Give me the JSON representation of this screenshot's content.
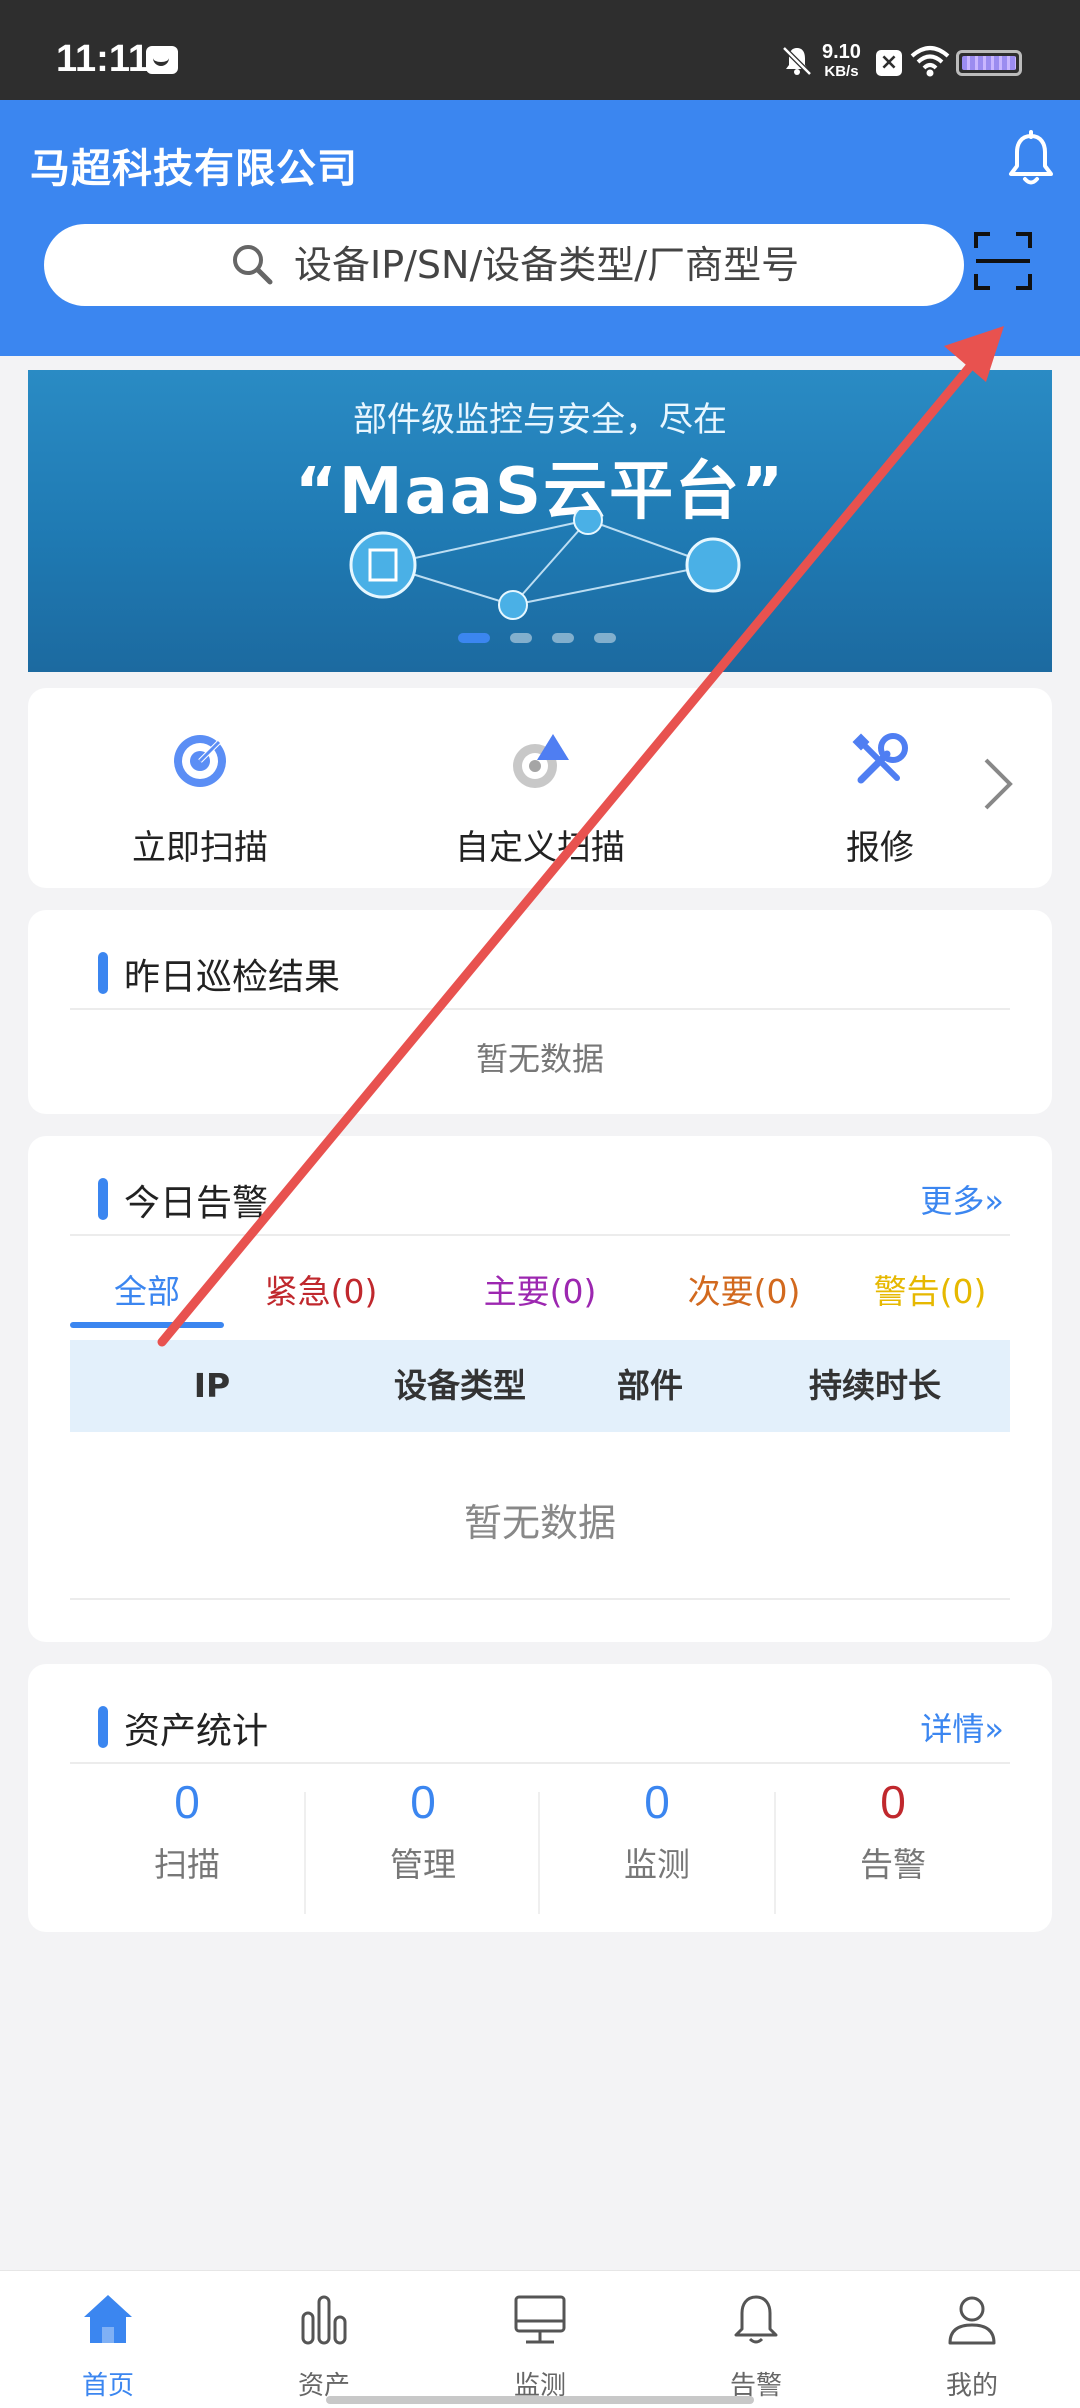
{
  "status_bar": {
    "time": "11:11",
    "net_speed_value": "9.10",
    "net_speed_unit": "KB/s",
    "x_badge": "×"
  },
  "header": {
    "company": "马超科技有限公司",
    "search_placeholder": "设备IP/SN/设备类型/厂商型号"
  },
  "banner": {
    "subtitle": "部件级监控与安全，尽在",
    "title": "“MaaS云平台”",
    "slide_count": 4,
    "active_slide": 1
  },
  "quick_actions": {
    "items": [
      {
        "label": "立即扫描",
        "icon": "target-icon"
      },
      {
        "label": "自定义扫描",
        "icon": "custom-scan-icon"
      },
      {
        "label": "报修",
        "icon": "wrench-icon"
      }
    ]
  },
  "yesterday": {
    "title": "昨日巡检结果",
    "empty": "暂无数据"
  },
  "today_alerts": {
    "title": "今日告警",
    "more": "更多»",
    "tabs": [
      {
        "label": "全部",
        "color": "#3b86f0"
      },
      {
        "label": "紧急(0)",
        "color": "#c0282d"
      },
      {
        "label": "主要(0)",
        "color": "#9c27b0"
      },
      {
        "label": "次要(0)",
        "color": "#d2691e"
      },
      {
        "label": "警告(0)",
        "color": "#e6b800"
      }
    ],
    "columns": [
      "IP",
      "设备类型",
      "部件",
      "持续时长"
    ],
    "empty": "暂无数据"
  },
  "assets": {
    "title": "资产统计",
    "details": "详情»",
    "stats": [
      {
        "value": "0",
        "label": "扫描",
        "color": "#3b86f0"
      },
      {
        "value": "0",
        "label": "管理",
        "color": "#3b86f0"
      },
      {
        "value": "0",
        "label": "监测",
        "color": "#3b86f0"
      },
      {
        "value": "0",
        "label": "告警",
        "color": "#c0282d"
      }
    ]
  },
  "bottom_nav": {
    "items": [
      {
        "label": "首页",
        "icon": "home-icon",
        "active": true
      },
      {
        "label": "资产",
        "icon": "bar-chart-icon",
        "active": false
      },
      {
        "label": "监测",
        "icon": "monitor-icon",
        "active": false
      },
      {
        "label": "告警",
        "icon": "bell-icon",
        "active": false
      },
      {
        "label": "我的",
        "icon": "user-icon",
        "active": false
      }
    ]
  },
  "annotation": {
    "color": "#e8524f"
  }
}
